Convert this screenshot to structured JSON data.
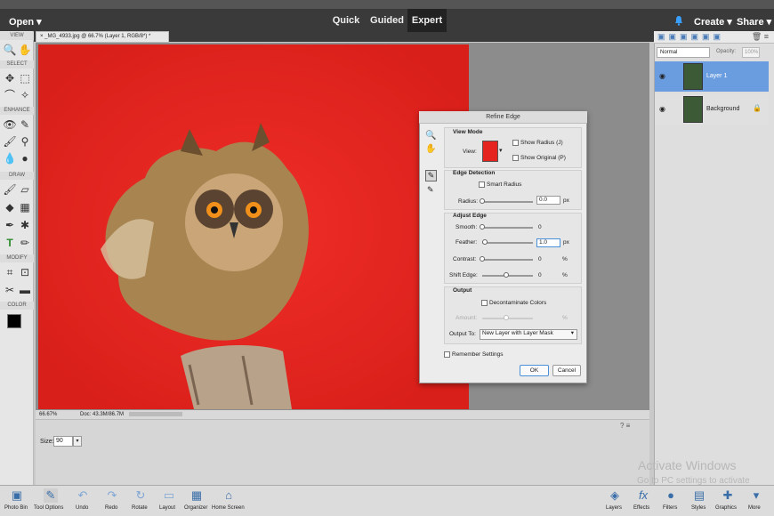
{
  "topbar": {
    "open_label": "Open",
    "modes": [
      "Quick",
      "Guided",
      "Expert"
    ],
    "create_label": "Create",
    "share_label": "Share"
  },
  "tools": {
    "sections": [
      "VIEW",
      "SELECT",
      "ENHANCE",
      "DRAW",
      "MODIFY",
      "COLOR"
    ]
  },
  "document": {
    "tab_title": "_MG_4933.jpg @ 66.7% (Layer 1, RGB/8*) *",
    "zoom": "66.67%",
    "doc_info": "Doc: 43.3M/86.7M"
  },
  "options": {
    "size_label": "Size:",
    "size_value": "90"
  },
  "layers": {
    "blend_mode": "Normal",
    "opacity_label": "Opacity:",
    "opacity_value": "100%",
    "items": [
      {
        "name": "Layer 1"
      },
      {
        "name": "Background"
      }
    ]
  },
  "dialog": {
    "title": "Refine Edge",
    "view_mode": {
      "title": "View Mode",
      "view_label": "View:",
      "show_radius": "Show Radius (J)",
      "show_original": "Show Original (P)"
    },
    "edge_detection": {
      "title": "Edge Detection",
      "smart_radius": "Smart Radius",
      "radius_label": "Radius:",
      "radius_value": "0.0",
      "radius_unit": "px"
    },
    "adjust_edge": {
      "title": "Adjust Edge",
      "smooth_label": "Smooth:",
      "smooth_value": "0",
      "feather_label": "Feather:",
      "feather_value": "1.0",
      "feather_unit": "px",
      "contrast_label": "Contrast:",
      "contrast_value": "0",
      "contrast_unit": "%",
      "shift_label": "Shift Edge:",
      "shift_value": "0",
      "shift_unit": "%"
    },
    "output": {
      "title": "Output",
      "decontaminate": "Decontaminate Colors",
      "amount_label": "Amount:",
      "amount_unit": "%",
      "output_to_label": "Output To:",
      "output_to_value": "New Layer with Layer Mask"
    },
    "remember": "Remember Settings",
    "ok": "OK",
    "cancel": "Cancel"
  },
  "bottombar": {
    "left": [
      "Photo Bin",
      "Tool Options",
      "Undo",
      "Redo",
      "Rotate",
      "Layout",
      "Organizer",
      "Home Screen"
    ],
    "right": [
      "Layers",
      "Effects",
      "Filters",
      "Styles",
      "Graphics",
      "More"
    ]
  },
  "watermark": {
    "line1": "Activate Windows",
    "line2": "Go to PC settings to activate"
  }
}
